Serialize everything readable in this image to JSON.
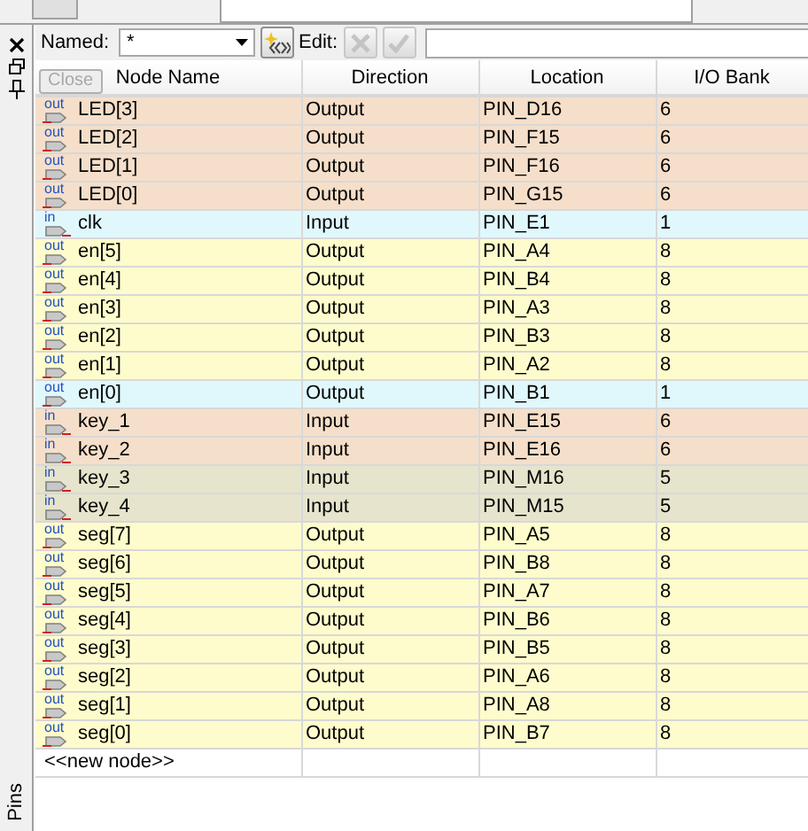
{
  "side_panel": {
    "title": "Pins"
  },
  "toolbar": {
    "named_label": "Named:",
    "named_value": "*",
    "edit_label": "Edit:"
  },
  "tooltip": {
    "text": "Close"
  },
  "table": {
    "columns": [
      "Node Name",
      "Direction",
      "Location",
      "I/O Bank"
    ],
    "rows": [
      {
        "kind": "out",
        "tag": "out",
        "name": "LED[3]",
        "direction": "Output",
        "location": "PIN_D16",
        "bank": "6",
        "color": "#f5dfca"
      },
      {
        "kind": "out",
        "tag": "out",
        "name": "LED[2]",
        "direction": "Output",
        "location": "PIN_F15",
        "bank": "6",
        "color": "#f5dfca"
      },
      {
        "kind": "out",
        "tag": "out",
        "name": "LED[1]",
        "direction": "Output",
        "location": "PIN_F16",
        "bank": "6",
        "color": "#f5dfca"
      },
      {
        "kind": "out",
        "tag": "out",
        "name": "LED[0]",
        "direction": "Output",
        "location": "PIN_G15",
        "bank": "6",
        "color": "#f5dfca"
      },
      {
        "kind": "in",
        "tag": "in",
        "name": "clk",
        "direction": "Input",
        "location": "PIN_E1",
        "bank": "1",
        "color": "#e0f8fc"
      },
      {
        "kind": "out",
        "tag": "out",
        "name": "en[5]",
        "direction": "Output",
        "location": "PIN_A4",
        "bank": "8",
        "color": "#fefccc"
      },
      {
        "kind": "out",
        "tag": "out",
        "name": "en[4]",
        "direction": "Output",
        "location": "PIN_B4",
        "bank": "8",
        "color": "#fefccc"
      },
      {
        "kind": "out",
        "tag": "out",
        "name": "en[3]",
        "direction": "Output",
        "location": "PIN_A3",
        "bank": "8",
        "color": "#fefccc"
      },
      {
        "kind": "out",
        "tag": "out",
        "name": "en[2]",
        "direction": "Output",
        "location": "PIN_B3",
        "bank": "8",
        "color": "#fefccc"
      },
      {
        "kind": "out",
        "tag": "out",
        "name": "en[1]",
        "direction": "Output",
        "location": "PIN_A2",
        "bank": "8",
        "color": "#fefccc"
      },
      {
        "kind": "out",
        "tag": "out",
        "name": "en[0]",
        "direction": "Output",
        "location": "PIN_B1",
        "bank": "1",
        "color": "#e0f8fc"
      },
      {
        "kind": "in",
        "tag": "in",
        "name": "key_1",
        "direction": "Input",
        "location": "PIN_E15",
        "bank": "6",
        "color": "#f5dfca"
      },
      {
        "kind": "in",
        "tag": "in",
        "name": "key_2",
        "direction": "Input",
        "location": "PIN_E16",
        "bank": "6",
        "color": "#f5dfca"
      },
      {
        "kind": "in",
        "tag": "in",
        "name": "key_3",
        "direction": "Input",
        "location": "PIN_M16",
        "bank": "5",
        "color": "#e6e4cc"
      },
      {
        "kind": "in",
        "tag": "in",
        "name": "key_4",
        "direction": "Input",
        "location": "PIN_M15",
        "bank": "5",
        "color": "#e6e4cc"
      },
      {
        "kind": "out",
        "tag": "out",
        "name": "seg[7]",
        "direction": "Output",
        "location": "PIN_A5",
        "bank": "8",
        "color": "#fefccc"
      },
      {
        "kind": "out",
        "tag": "out",
        "name": "seg[6]",
        "direction": "Output",
        "location": "PIN_B8",
        "bank": "8",
        "color": "#fefccc"
      },
      {
        "kind": "out",
        "tag": "out",
        "name": "seg[5]",
        "direction": "Output",
        "location": "PIN_A7",
        "bank": "8",
        "color": "#fefccc"
      },
      {
        "kind": "out",
        "tag": "out",
        "name": "seg[4]",
        "direction": "Output",
        "location": "PIN_B6",
        "bank": "8",
        "color": "#fefccc"
      },
      {
        "kind": "out",
        "tag": "out",
        "name": "seg[3]",
        "direction": "Output",
        "location": "PIN_B5",
        "bank": "8",
        "color": "#fefccc"
      },
      {
        "kind": "out",
        "tag": "out",
        "name": "seg[2]",
        "direction": "Output",
        "location": "PIN_A6",
        "bank": "8",
        "color": "#fefccc"
      },
      {
        "kind": "out",
        "tag": "out",
        "name": "seg[1]",
        "direction": "Output",
        "location": "PIN_A8",
        "bank": "8",
        "color": "#fefccc"
      },
      {
        "kind": "out",
        "tag": "out",
        "name": "seg[0]",
        "direction": "Output",
        "location": "PIN_B7",
        "bank": "8",
        "color": "#fefccc"
      }
    ],
    "new_node": "<<new node>>"
  }
}
